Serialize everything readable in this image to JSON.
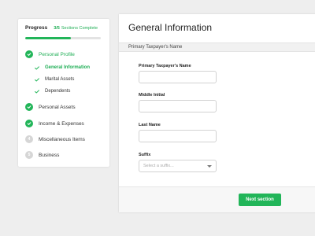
{
  "sidebar": {
    "progress_title": "Progress",
    "progress_count": "3/5",
    "progress_text": "Sections Complete",
    "progress_value": 0.6,
    "items": [
      {
        "label": "Personal Profile",
        "status": "done",
        "icon": "check-icon"
      },
      {
        "label": "Personal Assets",
        "status": "done",
        "icon": "check-icon"
      },
      {
        "label": "Income & Expenses",
        "status": "done",
        "icon": "check-icon"
      },
      {
        "label": "Miscellaneous Items",
        "status": "pending",
        "number": "4"
      },
      {
        "label": "Business",
        "status": "pending",
        "number": "5"
      }
    ],
    "subitems": [
      {
        "label": "General Information",
        "active": true
      },
      {
        "label": "Marital Assets",
        "active": false
      },
      {
        "label": "Dependents",
        "active": false
      }
    ]
  },
  "main": {
    "title": "General Information",
    "subtitle": "Primary Taxpayer's Name",
    "fields": {
      "primary_name": {
        "label": "Primary Taxpayer's Name",
        "value": "",
        "placeholder": ""
      },
      "middle_initial": {
        "label": "Middle Initial",
        "value": "",
        "placeholder": ""
      },
      "last_name": {
        "label": "Last Name",
        "value": "",
        "placeholder": ""
      },
      "suffix": {
        "label": "Suffix",
        "placeholder": "Select a suffix..."
      }
    },
    "next_label": "Next section"
  },
  "colors": {
    "accent": "#22b559",
    "background": "#eeeeee",
    "pending": "#d6d6d6"
  }
}
